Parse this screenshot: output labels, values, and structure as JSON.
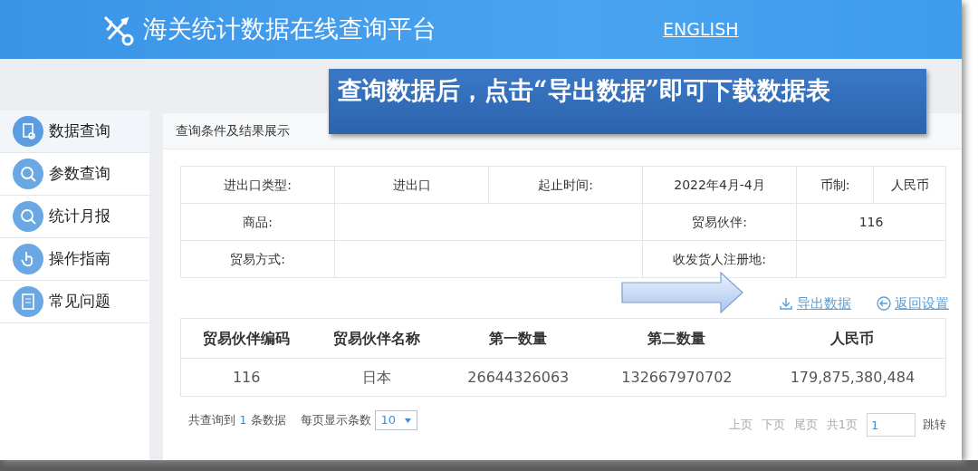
{
  "header": {
    "title": "海关统计数据在线查询平台",
    "english_link": "ENGLISH"
  },
  "callout": "查询数据后，点击“导出数据”即可下载数据表",
  "sidebar": {
    "items": [
      {
        "label": "数据查询",
        "selected": true
      },
      {
        "label": "参数查询",
        "selected": false
      },
      {
        "label": "统计月报",
        "selected": false
      },
      {
        "label": "操作指南",
        "selected": false
      },
      {
        "label": "常见问题",
        "selected": false
      }
    ]
  },
  "panel": {
    "title": "查询条件及结果展示",
    "conditions": [
      {
        "label": "进出口类型:",
        "value": "进出口"
      },
      {
        "label": "起止时间:",
        "value": "2022年4月-4月"
      },
      {
        "label": "币制:",
        "value": "人民币"
      },
      {
        "label": "商品:"
      },
      {
        "label": "贸易伙伴:",
        "value": "116"
      },
      {
        "label": "贸易方式:"
      },
      {
        "label": "收发货人注册地:"
      }
    ],
    "actions": {
      "export": "导出数据",
      "back": "返回设置"
    },
    "results": {
      "columns": [
        "贸易伙伴编码",
        "贸易伙伴名称",
        "第一数量",
        "第二数量",
        "人民币"
      ],
      "rows": [
        [
          "116",
          "日本",
          "26644326063",
          "132667970702",
          "179,875,380,484"
        ]
      ]
    },
    "footer": {
      "summary_prefix": "共查询到",
      "count": "1",
      "summary_suffix": "条数据",
      "page_size_label": "每页显示条数",
      "page_size": "10",
      "pager": [
        "上页",
        "下页",
        "尾页",
        "共1页"
      ],
      "page_input": "1",
      "jump": "跳转"
    }
  }
}
